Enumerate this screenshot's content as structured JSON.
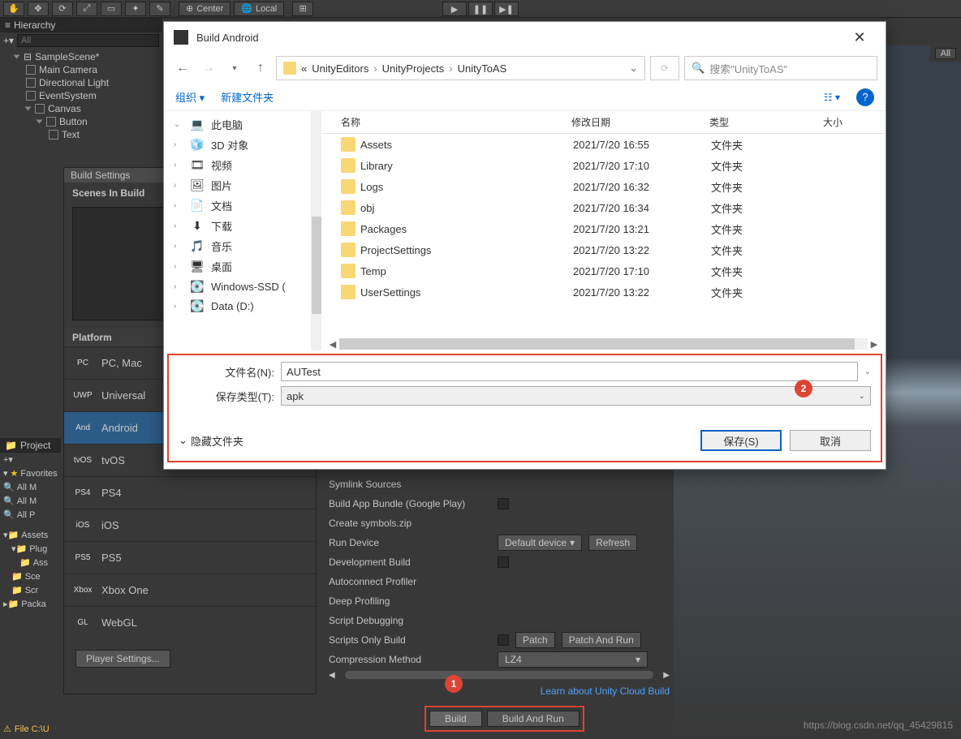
{
  "toolbar": {
    "center": "Center",
    "local": "Local"
  },
  "hierarchy": {
    "title": "Hierarchy",
    "search_placeholder": "All",
    "scene": "SampleScene*",
    "items": [
      "Main Camera",
      "Directional Light",
      "EventSystem"
    ],
    "canvas": "Canvas",
    "button": "Button",
    "text": "Text"
  },
  "buildSettings": {
    "title": "Build Settings",
    "scenesLabel": "Scenes In Build",
    "platformLabel": "Platform",
    "platforms": [
      {
        "name": "PC, Mac",
        "abbr": "PC"
      },
      {
        "name": "Universal",
        "abbr": "UWP"
      },
      {
        "name": "Android",
        "abbr": "And"
      },
      {
        "name": "tvOS",
        "abbr": "tvOS"
      },
      {
        "name": "PS4",
        "abbr": "PS4"
      },
      {
        "name": "iOS",
        "abbr": "iOS"
      },
      {
        "name": "PS5",
        "abbr": "PS5"
      },
      {
        "name": "Xbox One",
        "abbr": "Xbox"
      },
      {
        "name": "WebGL",
        "abbr": "GL"
      }
    ],
    "playerSettings": "Player Settings..."
  },
  "rightSettings": {
    "symlink": "Symlink Sources",
    "bundle": "Build App Bundle (Google Play)",
    "symbols": "Create symbols.zip",
    "runDevice": "Run Device",
    "runDeviceValue": "Default device",
    "refresh": "Refresh",
    "devBuild": "Development Build",
    "autoconnect": "Autoconnect Profiler",
    "deep": "Deep Profiling",
    "scriptDebug": "Script Debugging",
    "scriptsOnly": "Scripts Only Build",
    "patch": "Patch",
    "patchRun": "Patch And Run",
    "compression": "Compression Method",
    "compressionValue": "LZ4",
    "learn": "Learn about Unity Cloud Build",
    "build": "Build",
    "buildRun": "Build And Run"
  },
  "project": {
    "title": "Project",
    "favorites": "Favorites",
    "allItems": [
      "All M",
      "All M",
      "All P"
    ],
    "assets": "Assets",
    "plugins": "Plug",
    "sub": [
      "Ass",
      "Sce",
      "Scr"
    ],
    "packages": "Packa"
  },
  "fileErr": "File C:\\U",
  "dialog": {
    "title": "Build Android",
    "breadcrumb": [
      "UnityEditors",
      "UnityProjects",
      "UnityToAS"
    ],
    "breadcrumbPrefix": "«",
    "searchPlaceholder": "搜索\"UnityToAS\"",
    "organize": "组织",
    "newFolder": "新建文件夹",
    "sidebar": [
      {
        "icon": "💻",
        "label": "此电脑"
      },
      {
        "icon": "🧊",
        "label": "3D 对象"
      },
      {
        "icon": "🎞",
        "label": "视频"
      },
      {
        "icon": "🖼",
        "label": "图片"
      },
      {
        "icon": "📄",
        "label": "文档"
      },
      {
        "icon": "⬇",
        "label": "下载"
      },
      {
        "icon": "🎵",
        "label": "音乐"
      },
      {
        "icon": "🖥",
        "label": "桌面"
      },
      {
        "icon": "💽",
        "label": "Windows-SSD ("
      },
      {
        "icon": "💽",
        "label": "Data (D:)"
      }
    ],
    "columns": {
      "name": "名称",
      "date": "修改日期",
      "type": "类型",
      "size": "大小"
    },
    "files": [
      {
        "name": "Assets",
        "date": "2021/7/20 16:55",
        "type": "文件夹"
      },
      {
        "name": "Library",
        "date": "2021/7/20 17:10",
        "type": "文件夹"
      },
      {
        "name": "Logs",
        "date": "2021/7/20 16:32",
        "type": "文件夹"
      },
      {
        "name": "obj",
        "date": "2021/7/20 16:34",
        "type": "文件夹"
      },
      {
        "name": "Packages",
        "date": "2021/7/20 13:21",
        "type": "文件夹"
      },
      {
        "name": "ProjectSettings",
        "date": "2021/7/20 13:22",
        "type": "文件夹"
      },
      {
        "name": "Temp",
        "date": "2021/7/20 17:10",
        "type": "文件夹"
      },
      {
        "name": "UserSettings",
        "date": "2021/7/20 13:22",
        "type": "文件夹"
      }
    ],
    "filenameLabel": "文件名(N):",
    "filenameValue": "AUTest",
    "filetypeLabel": "保存类型(T):",
    "filetypeValue": "apk",
    "hideFolders": "隐藏文件夹",
    "save": "保存(S)",
    "cancel": "取消"
  },
  "topRight": {
    "all": "All"
  },
  "badges": {
    "b1": "1",
    "b2": "2"
  },
  "watermark": "https://blog.csdn.net/qq_45429815"
}
